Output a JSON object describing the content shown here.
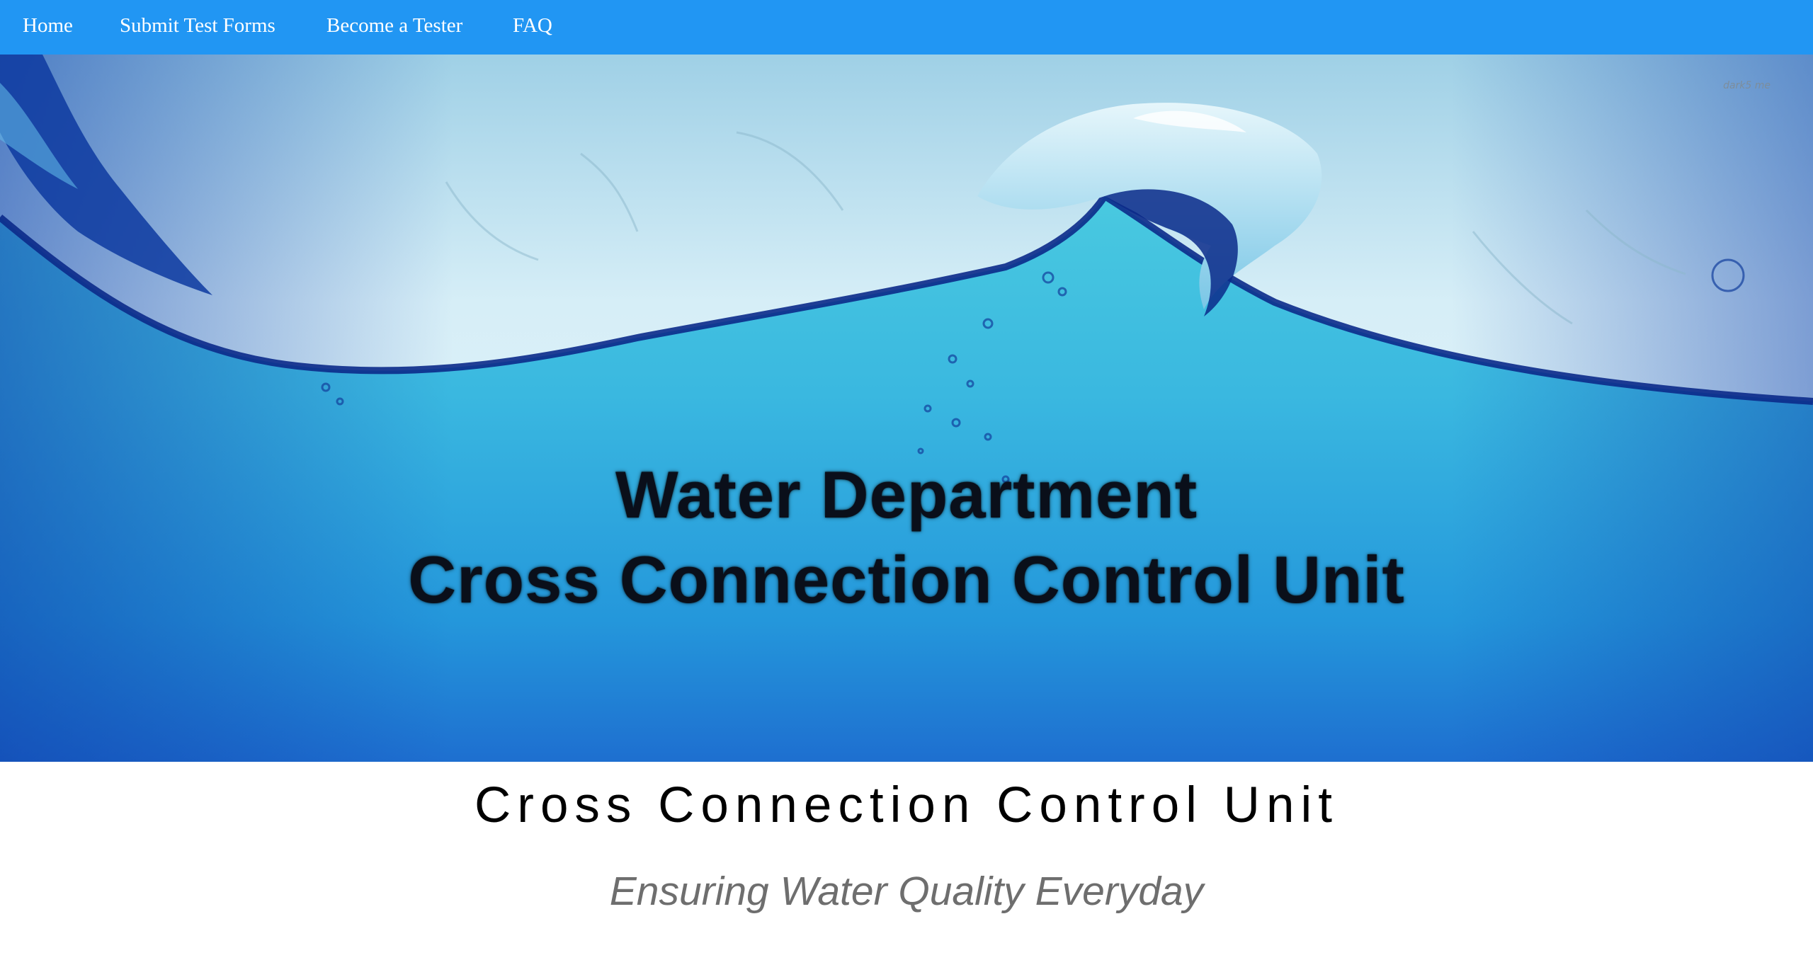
{
  "nav": {
    "items": [
      {
        "label": "Home"
      },
      {
        "label": "Submit Test Forms"
      },
      {
        "label": "Become a Tester"
      },
      {
        "label": "FAQ"
      }
    ],
    "background_color": "#2196f3"
  },
  "hero": {
    "line1": "Water Department",
    "line2": "Cross Connection Control Unit",
    "watermark": "dark5 me"
  },
  "main": {
    "title": "Cross Connection Control Unit",
    "tagline": "Ensuring Water Quality Everyday"
  },
  "colors": {
    "nav": "#2196f3",
    "tagline": "#6e6e6e"
  }
}
